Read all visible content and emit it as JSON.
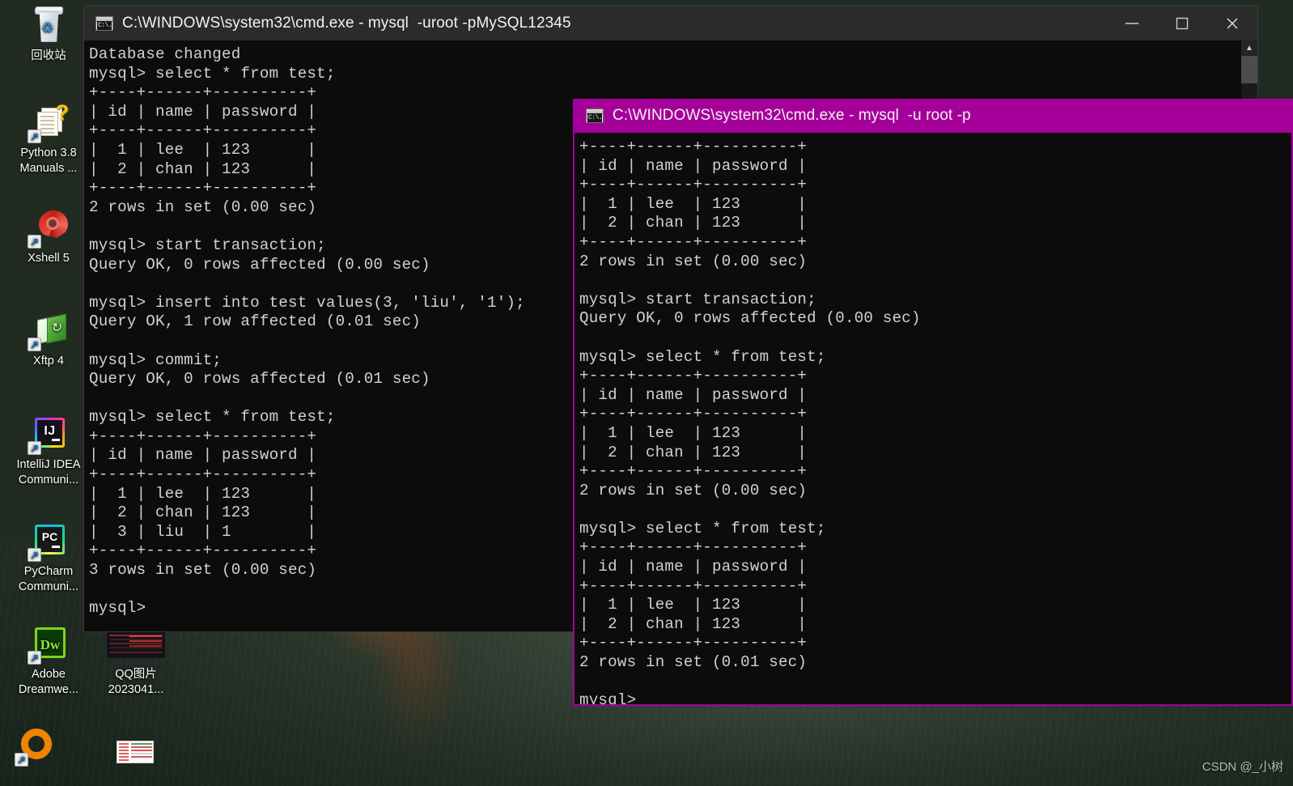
{
  "desktop": {
    "icons": [
      {
        "name": "recycle-bin",
        "label": "回收站",
        "glyph": "recycle-bin-icon"
      },
      {
        "name": "python-manuals",
        "label": "Python 3.8\nManuals ...",
        "glyph": "python-help-doc-icon"
      },
      {
        "name": "xshell-5",
        "label": "Xshell 5",
        "glyph": "xshell-spiral-icon"
      },
      {
        "name": "xftp-4",
        "label": "Xftp 4",
        "glyph": "xftp-folder-icon"
      },
      {
        "name": "intellij-idea",
        "label": "IntelliJ IDEA\nCommuni...",
        "glyph": "intellij-idea-icon"
      },
      {
        "name": "pycharm",
        "label": "PyCharm\nCommuni...",
        "glyph": "pycharm-icon"
      },
      {
        "name": "adobe-dreamweaver",
        "label": "Adobe\nDreamwe...",
        "glyph": "dreamweaver-icon"
      },
      {
        "name": "qq-image",
        "label": "QQ图片\n2023041...",
        "glyph": "image-thumbnail-icon"
      },
      {
        "name": "orange-ring-app",
        "label": "",
        "glyph": "orange-ring-icon"
      },
      {
        "name": "document-thumbnail",
        "label": "",
        "glyph": "document-thumbnail-icon"
      }
    ],
    "watermark": "CSDN @_小树"
  },
  "windows": {
    "window1": {
      "title": "C:\\WINDOWS\\system32\\cmd.exe - mysql  -uroot -pMySQL12345",
      "icon": "cmd-console-icon",
      "active": false,
      "titlebar_color": "#2b2b2b",
      "buttons": {
        "minimize": "minimize-button",
        "maximize": "maximize-button",
        "close": "close-button"
      },
      "scrollbar": {
        "up_arrow": "▲",
        "down_arrow": "▼"
      },
      "content": "Database changed\nmysql> select * from test;\n+----+------+----------+\n| id | name | password |\n+----+------+----------+\n|  1 | lee  | 123      |\n|  2 | chan | 123      |\n+----+------+----------+\n2 rows in set (0.00 sec)\n\nmysql> start transaction;\nQuery OK, 0 rows affected (0.00 sec)\n\nmysql> insert into test values(3, 'liu', '1');\nQuery OK, 1 row affected (0.01 sec)\n\nmysql> commit;\nQuery OK, 0 rows affected (0.01 sec)\n\nmysql> select * from test;\n+----+------+----------+\n| id | name | password |\n+----+------+----------+\n|  1 | lee  | 123      |\n|  2 | chan | 123      |\n|  3 | liu  | 1        |\n+----+------+----------+\n3 rows in set (0.00 sec)\n\nmysql>"
    },
    "window2": {
      "title": "C:\\WINDOWS\\system32\\cmd.exe - mysql  -u root -p",
      "icon": "cmd-console-icon",
      "active": true,
      "titlebar_color": "#a6009a",
      "content": "+----+------+----------+\n| id | name | password |\n+----+------+----------+\n|  1 | lee  | 123      |\n|  2 | chan | 123      |\n+----+------+----------+\n2 rows in set (0.00 sec)\n\nmysql> start transaction;\nQuery OK, 0 rows affected (0.00 sec)\n\nmysql> select * from test;\n+----+------+----------+\n| id | name | password |\n+----+------+----------+\n|  1 | lee  | 123      |\n|  2 | chan | 123      |\n+----+------+----------+\n2 rows in set (0.00 sec)\n\nmysql> select * from test;\n+----+------+----------+\n| id | name | password |\n+----+------+----------+\n|  1 | lee  | 123      |\n|  2 | chan | 123      |\n+----+------+----------+\n2 rows in set (0.01 sec)\n\nmysql>"
    }
  }
}
